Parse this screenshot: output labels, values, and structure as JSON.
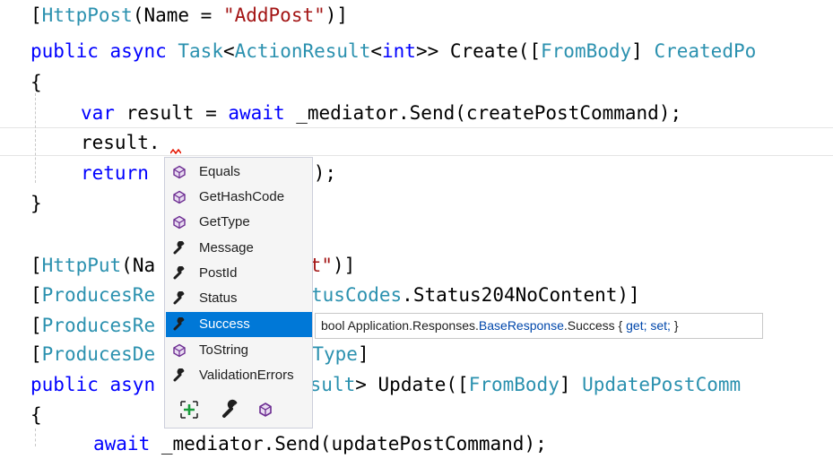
{
  "editor": {
    "lines": [
      {
        "parts": [
          "[",
          "HttpPost",
          "(Name = ",
          "\"AddPost\"",
          ")]"
        ]
      },
      {
        "parts": [
          "public",
          " ",
          "async",
          " ",
          "Task",
          "<",
          "ActionResult",
          "<",
          "int",
          ">> Create([",
          "FromBody",
          "] ",
          "CreatedPo"
        ]
      },
      {
        "text": "{"
      },
      {
        "parts": [
          "var",
          " result = ",
          "await",
          " _mediator.Send(createPostCommand);"
        ]
      },
      {
        "text": "result."
      },
      {
        "parts": [
          "return",
          " ",
          "ostId);"
        ]
      },
      {
        "text": "}"
      },
      {
        "parts": [
          "[",
          "HttpPut",
          "(Na",
          "ePost\"",
          ")]"
        ]
      },
      {
        "parts": [
          "[",
          "ProducesRe",
          "StatusCodes",
          ".Status204NoContent)]"
        ]
      },
      {
        "parts": [
          "[",
          "ProducesRe"
        ]
      },
      {
        "parts": [
          "[",
          "ProducesDe",
          "seType",
          "]"
        ]
      },
      {
        "parts": [
          "public",
          " ",
          "asyn",
          "onResult",
          "> Update([",
          "FromBody",
          "] ",
          "UpdatePostComm"
        ]
      },
      {
        "text": "{"
      },
      {
        "parts": [
          "await",
          " _mediator.Send(updatePostCommand);"
        ]
      }
    ]
  },
  "completion": {
    "items": [
      {
        "label": "Equals",
        "icon": "method-icon",
        "selected": false
      },
      {
        "label": "GetHashCode",
        "icon": "method-icon",
        "selected": false
      },
      {
        "label": "GetType",
        "icon": "method-icon",
        "selected": false
      },
      {
        "label": "Message",
        "icon": "wrench-icon",
        "selected": false
      },
      {
        "label": "PostId",
        "icon": "wrench-icon",
        "selected": false
      },
      {
        "label": "Status",
        "icon": "wrench-icon",
        "selected": false
      },
      {
        "label": "Success",
        "icon": "wrench-icon",
        "selected": true
      },
      {
        "label": "ToString",
        "icon": "method-icon",
        "selected": false
      },
      {
        "label": "ValidationErrors",
        "icon": "wrench-icon",
        "selected": false
      }
    ],
    "filters": [
      "expand-icon",
      "property-filter-icon",
      "method-filter-icon"
    ]
  },
  "tooltip": {
    "prefix": "bool Application.Responses.",
    "type_link": "BaseResponse",
    "member": ".Success { ",
    "get": "get;",
    "space": " ",
    "set": "set;",
    "suffix": " }"
  },
  "colors": {
    "keyword": "#0000ff",
    "type": "#2b91af",
    "string": "#a31515",
    "selection": "#0078d7",
    "method_icon": "#6c2c91"
  }
}
